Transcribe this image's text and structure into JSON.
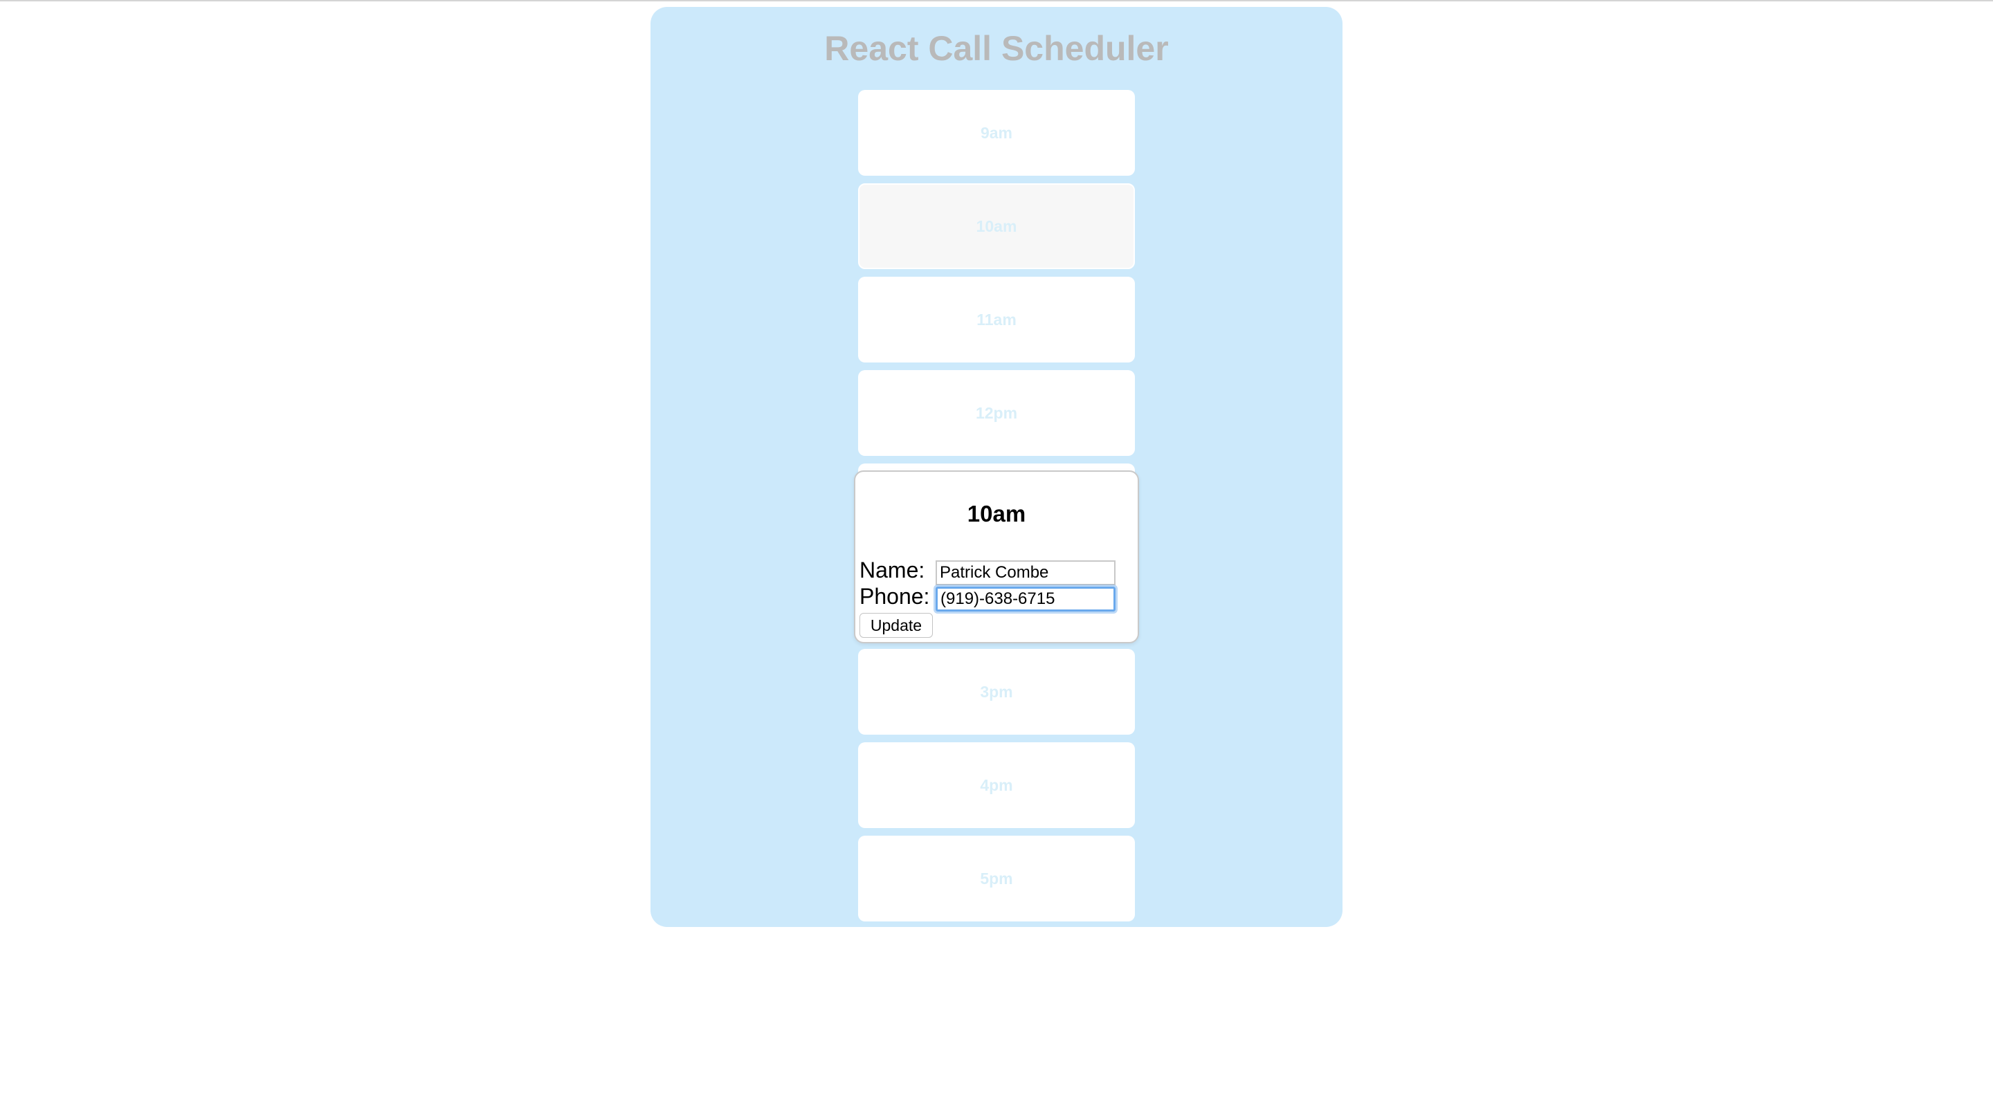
{
  "app": {
    "title": "React Call Scheduler"
  },
  "slots": [
    {
      "label": "9am"
    },
    {
      "label": "10am"
    },
    {
      "label": "11am"
    },
    {
      "label": "12pm"
    },
    {
      "label": "3pm"
    },
    {
      "label": "4pm"
    },
    {
      "label": "5pm"
    }
  ],
  "modal": {
    "title": "10am",
    "name_label": "Name:",
    "name_value": "Patrick Combe",
    "phone_label": "Phone:",
    "phone_value": "(919)-638-6715",
    "update_label": "Update"
  },
  "colors": {
    "panel_background": "#cce9fb",
    "title_text": "#b9b9b9",
    "slot_text": "#d9eff9",
    "focus_ring": "#6aa9ec"
  }
}
